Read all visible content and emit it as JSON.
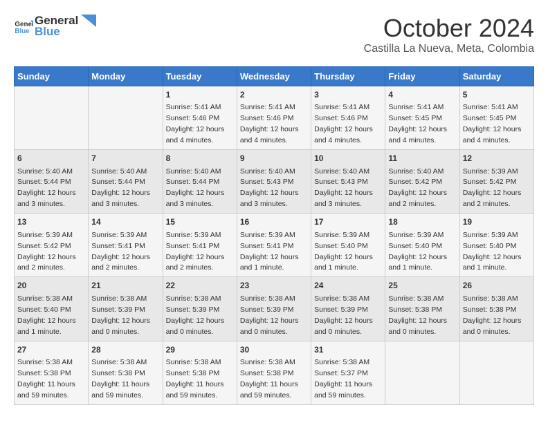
{
  "header": {
    "logo_line1": "General",
    "logo_line2": "Blue",
    "month": "October 2024",
    "location": "Castilla La Nueva, Meta, Colombia"
  },
  "weekdays": [
    "Sunday",
    "Monday",
    "Tuesday",
    "Wednesday",
    "Thursday",
    "Friday",
    "Saturday"
  ],
  "weeks": [
    [
      {
        "day": "",
        "info": ""
      },
      {
        "day": "",
        "info": ""
      },
      {
        "day": "1",
        "info": "Sunrise: 5:41 AM\nSunset: 5:46 PM\nDaylight: 12 hours\nand 4 minutes."
      },
      {
        "day": "2",
        "info": "Sunrise: 5:41 AM\nSunset: 5:46 PM\nDaylight: 12 hours\nand 4 minutes."
      },
      {
        "day": "3",
        "info": "Sunrise: 5:41 AM\nSunset: 5:46 PM\nDaylight: 12 hours\nand 4 minutes."
      },
      {
        "day": "4",
        "info": "Sunrise: 5:41 AM\nSunset: 5:45 PM\nDaylight: 12 hours\nand 4 minutes."
      },
      {
        "day": "5",
        "info": "Sunrise: 5:41 AM\nSunset: 5:45 PM\nDaylight: 12 hours\nand 4 minutes."
      }
    ],
    [
      {
        "day": "6",
        "info": "Sunrise: 5:40 AM\nSunset: 5:44 PM\nDaylight: 12 hours\nand 3 minutes."
      },
      {
        "day": "7",
        "info": "Sunrise: 5:40 AM\nSunset: 5:44 PM\nDaylight: 12 hours\nand 3 minutes."
      },
      {
        "day": "8",
        "info": "Sunrise: 5:40 AM\nSunset: 5:44 PM\nDaylight: 12 hours\nand 3 minutes."
      },
      {
        "day": "9",
        "info": "Sunrise: 5:40 AM\nSunset: 5:43 PM\nDaylight: 12 hours\nand 3 minutes."
      },
      {
        "day": "10",
        "info": "Sunrise: 5:40 AM\nSunset: 5:43 PM\nDaylight: 12 hours\nand 3 minutes."
      },
      {
        "day": "11",
        "info": "Sunrise: 5:40 AM\nSunset: 5:42 PM\nDaylight: 12 hours\nand 2 minutes."
      },
      {
        "day": "12",
        "info": "Sunrise: 5:39 AM\nSunset: 5:42 PM\nDaylight: 12 hours\nand 2 minutes."
      }
    ],
    [
      {
        "day": "13",
        "info": "Sunrise: 5:39 AM\nSunset: 5:42 PM\nDaylight: 12 hours\nand 2 minutes."
      },
      {
        "day": "14",
        "info": "Sunrise: 5:39 AM\nSunset: 5:41 PM\nDaylight: 12 hours\nand 2 minutes."
      },
      {
        "day": "15",
        "info": "Sunrise: 5:39 AM\nSunset: 5:41 PM\nDaylight: 12 hours\nand 2 minutes."
      },
      {
        "day": "16",
        "info": "Sunrise: 5:39 AM\nSunset: 5:41 PM\nDaylight: 12 hours\nand 1 minute."
      },
      {
        "day": "17",
        "info": "Sunrise: 5:39 AM\nSunset: 5:40 PM\nDaylight: 12 hours\nand 1 minute."
      },
      {
        "day": "18",
        "info": "Sunrise: 5:39 AM\nSunset: 5:40 PM\nDaylight: 12 hours\nand 1 minute."
      },
      {
        "day": "19",
        "info": "Sunrise: 5:39 AM\nSunset: 5:40 PM\nDaylight: 12 hours\nand 1 minute."
      }
    ],
    [
      {
        "day": "20",
        "info": "Sunrise: 5:38 AM\nSunset: 5:40 PM\nDaylight: 12 hours\nand 1 minute."
      },
      {
        "day": "21",
        "info": "Sunrise: 5:38 AM\nSunset: 5:39 PM\nDaylight: 12 hours\nand 0 minutes."
      },
      {
        "day": "22",
        "info": "Sunrise: 5:38 AM\nSunset: 5:39 PM\nDaylight: 12 hours\nand 0 minutes."
      },
      {
        "day": "23",
        "info": "Sunrise: 5:38 AM\nSunset: 5:39 PM\nDaylight: 12 hours\nand 0 minutes."
      },
      {
        "day": "24",
        "info": "Sunrise: 5:38 AM\nSunset: 5:39 PM\nDaylight: 12 hours\nand 0 minutes."
      },
      {
        "day": "25",
        "info": "Sunrise: 5:38 AM\nSunset: 5:38 PM\nDaylight: 12 hours\nand 0 minutes."
      },
      {
        "day": "26",
        "info": "Sunrise: 5:38 AM\nSunset: 5:38 PM\nDaylight: 12 hours\nand 0 minutes."
      }
    ],
    [
      {
        "day": "27",
        "info": "Sunrise: 5:38 AM\nSunset: 5:38 PM\nDaylight: 11 hours\nand 59 minutes."
      },
      {
        "day": "28",
        "info": "Sunrise: 5:38 AM\nSunset: 5:38 PM\nDaylight: 11 hours\nand 59 minutes."
      },
      {
        "day": "29",
        "info": "Sunrise: 5:38 AM\nSunset: 5:38 PM\nDaylight: 11 hours\nand 59 minutes."
      },
      {
        "day": "30",
        "info": "Sunrise: 5:38 AM\nSunset: 5:38 PM\nDaylight: 11 hours\nand 59 minutes."
      },
      {
        "day": "31",
        "info": "Sunrise: 5:38 AM\nSunset: 5:37 PM\nDaylight: 11 hours\nand 59 minutes."
      },
      {
        "day": "",
        "info": ""
      },
      {
        "day": "",
        "info": ""
      }
    ]
  ]
}
